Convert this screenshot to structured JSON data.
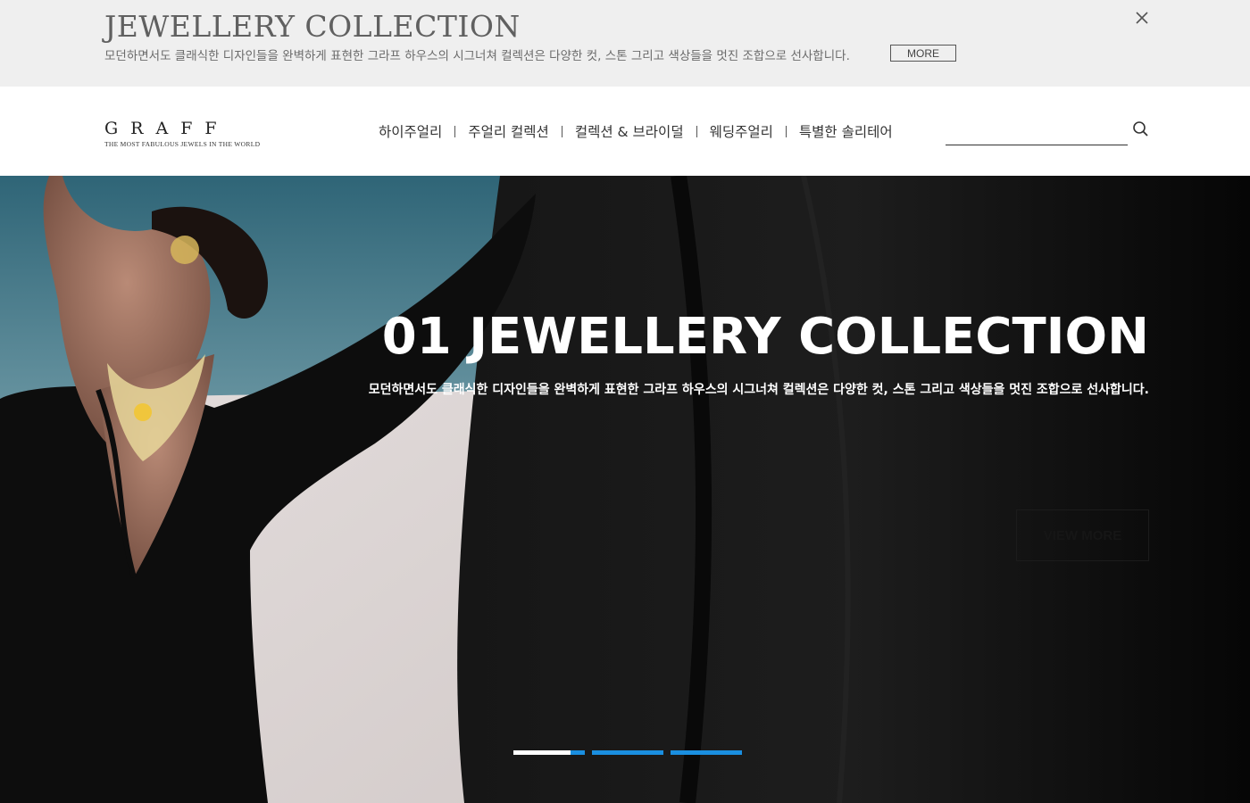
{
  "promo": {
    "title": "JEWELLERY COLLECTION",
    "description": "모던하면서도 클래식한 디자인들을 완벽하게 표현한 그라프 하우스의 시그너쳐 컬렉션은 다양한 컷, 스톤 그리고 색상들을 멋진 조합으로 선사합니다.",
    "more_label": "MORE",
    "close_icon": "close-icon"
  },
  "header": {
    "logo_word": "GRAFF",
    "logo_tagline": "THE MOST FABULOUS JEWELS IN THE WORLD",
    "nav": [
      {
        "label": "하이주얼리"
      },
      {
        "label": "주얼리 컬렉션"
      },
      {
        "label": "컬렉션 & 브라이덜"
      },
      {
        "label": "웨딩주얼리"
      },
      {
        "label": "특별한 솔리테어"
      }
    ],
    "search_value": "",
    "search_icon": "search-icon"
  },
  "hero": {
    "title": "01 JEWELLERY COLLECTION",
    "description": "모던하면서도 클래식한 디자인들을 완벽하게 표현한 그라프 하우스의 시그너쳐 컬렉션은 다양한 컷, 스톤 그리고 색상들을 멋진 조합으로 선사합니다.",
    "view_more_label": "VIEW MORE",
    "slides": 3,
    "active_slide": 1
  },
  "colors": {
    "promo_bg": "#efefef",
    "pager_accent": "#1a8fe0",
    "hero_dark": "#0a0a0a"
  }
}
